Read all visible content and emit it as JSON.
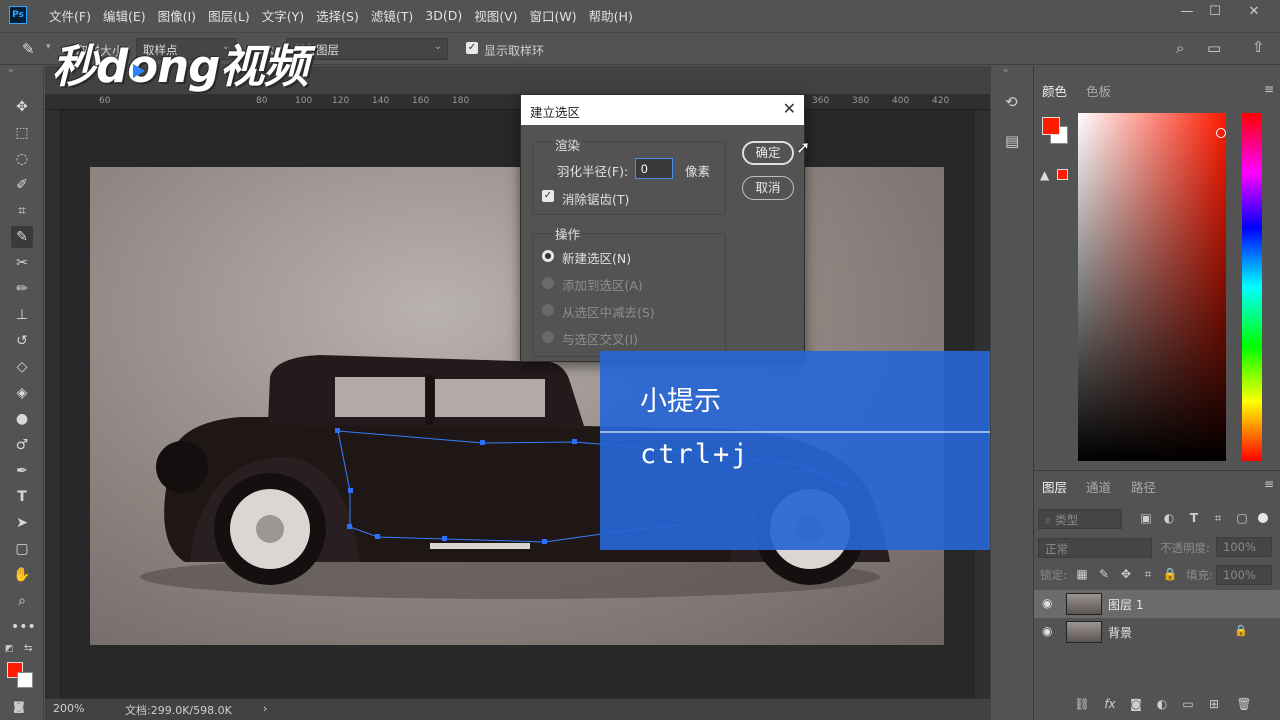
{
  "app": {
    "logo": "Ps"
  },
  "menu": [
    "文件(F)",
    "编辑(E)",
    "图像(I)",
    "图层(L)",
    "文字(Y)",
    "选择(S)",
    "滤镜(T)",
    "3D(D)",
    "视图(V)",
    "窗口(W)",
    "帮助(H)"
  ],
  "options": {
    "sample_size_label": "取样大小:",
    "sample_size_value": "取样点",
    "sample_label": "样本:",
    "sample_value": "所有图层",
    "show_ring_label": "显示取样环"
  },
  "watermark": {
    "text_a": "秒d",
    "text_o": "o",
    "text_b": "ng视频"
  },
  "ruler": {
    "ticks": [
      "60",
      "80",
      "100",
      "120",
      "140",
      "160",
      "180",
      "360",
      "380",
      "400",
      "420"
    ]
  },
  "status": {
    "zoom": "200%",
    "doc": "文档:299.0K/598.0K",
    "arrow": "›"
  },
  "dialog": {
    "title": "建立选区",
    "render_group": "渲染",
    "feather_label": "羽化半径(F):",
    "feather_value": "0",
    "feather_unit": "像素",
    "antialias_label": "消除锯齿(T)",
    "ops_group": "操作",
    "op_new": "新建选区(N)",
    "op_add": "添加到选区(A)",
    "op_sub": "从选区中减去(S)",
    "op_intersect": "与选区交叉(I)",
    "ok": "确定",
    "cancel": "取消"
  },
  "tip": {
    "title": "小提示",
    "body": "ctrl+j"
  },
  "color_panel": {
    "tab_color": "颜色",
    "tab_swatches": "色板",
    "fg": "#ff1a00",
    "bg": "#ffffff"
  },
  "layers_panel": {
    "tab_layers": "图层",
    "tab_channels": "通道",
    "tab_paths": "路径",
    "filter_placeholder": "类型",
    "blend_mode": "正常",
    "opacity_label": "不透明度:",
    "opacity_value": "100%",
    "lock_label": "锁定:",
    "fill_label": "填充:",
    "fill_value": "100%",
    "layers": [
      {
        "name": "图层 1",
        "selected": true
      },
      {
        "name": "背景",
        "selected": false
      }
    ]
  }
}
